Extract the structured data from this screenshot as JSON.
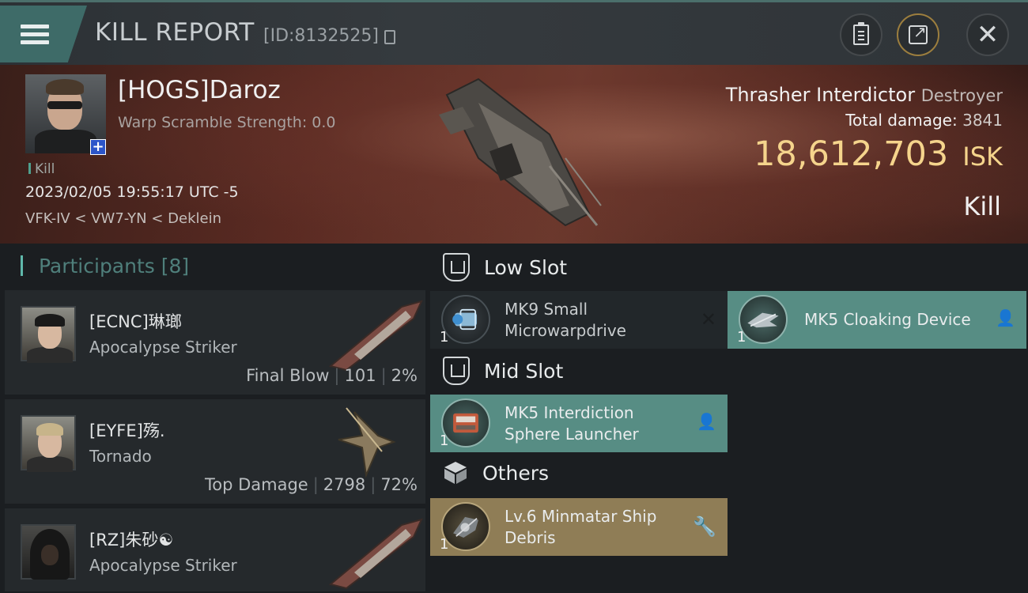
{
  "header": {
    "title": "KILL REPORT",
    "report_id": "[ID:8132525]"
  },
  "victim": {
    "name": "[HOGS]Daroz",
    "subtitle": "Warp Scramble Strength: 0.0",
    "tag": "Kill",
    "timestamp": "2023/02/05 19:55:17 UTC -5",
    "location": "VFK-IV < VW7-YN < Deklein",
    "ship_name": "Thrasher Interdictor",
    "ship_class": "Destroyer",
    "total_damage_label": "Total damage:",
    "total_damage": "3841",
    "isk_value": "18,612,703",
    "isk_unit": "ISK",
    "result": "Kill"
  },
  "participants": {
    "label": "Participants",
    "count": "[8]",
    "rows": [
      {
        "name": "[ECNC]琳瑯",
        "ship": "Apocalypse Striker",
        "stat_label": "Final Blow",
        "damage": "101",
        "percent": "2%"
      },
      {
        "name": "[EYFE]殇.",
        "ship": "Tornado",
        "stat_label": "Top Damage",
        "damage": "2798",
        "percent": "72%"
      },
      {
        "name": "[RZ]朱砂☯",
        "ship": "Apocalypse Striker"
      }
    ]
  },
  "slots": {
    "low": {
      "label": "Low Slot",
      "modules": [
        {
          "name_line1": "MK9 Small",
          "name_line2": "Microwarpdrive",
          "qty": "1",
          "state": "destroyed"
        },
        {
          "name_line1": "MK5 Cloaking Device",
          "name_line2": "",
          "qty": "1",
          "state": "dropped"
        }
      ]
    },
    "mid": {
      "label": "Mid Slot",
      "modules": [
        {
          "name_line1": "MK5 Interdiction",
          "name_line2": "Sphere Launcher",
          "qty": "1",
          "state": "dropped"
        }
      ]
    },
    "others": {
      "label": "Others",
      "modules": [
        {
          "name_line1": "Lv.6 Minmatar Ship",
          "name_line2": "Debris",
          "qty": "1",
          "state": "salvage"
        }
      ]
    }
  },
  "colors": {
    "accent_teal": "#578d84",
    "isk_gold": "#f5d48c",
    "salvage_gold": "#8f7d56"
  }
}
